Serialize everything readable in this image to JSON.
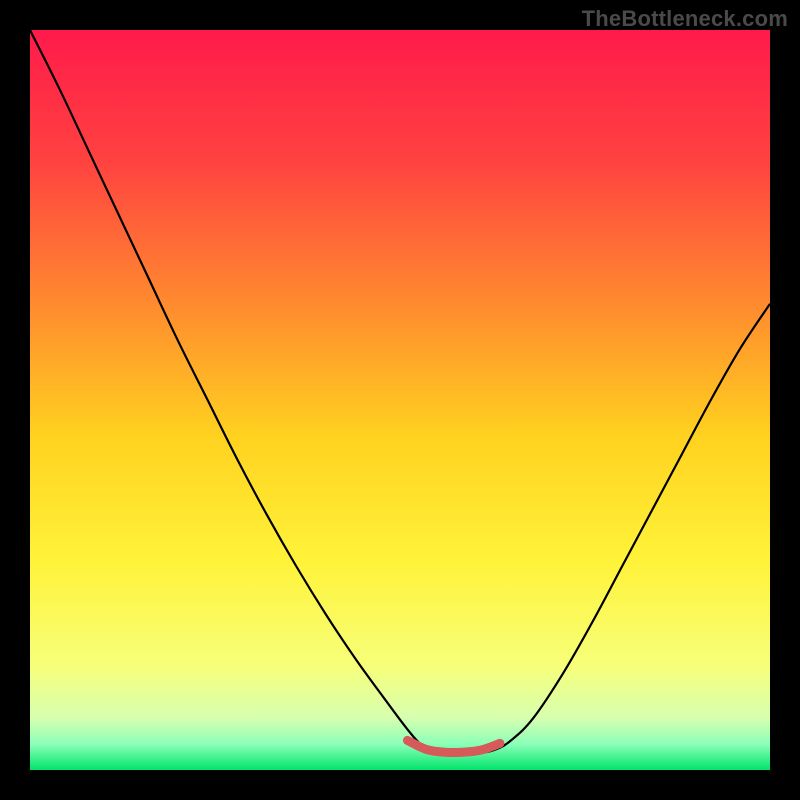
{
  "watermark": "TheBottleneck.com",
  "chart_data": {
    "type": "line",
    "title": "",
    "xlabel": "",
    "ylabel": "",
    "xlim": [
      0,
      100
    ],
    "ylim": [
      0,
      100
    ],
    "grid": false,
    "legend": false,
    "background_gradient": {
      "stops": [
        {
          "pos": 0.0,
          "color": "#ff1a4b"
        },
        {
          "pos": 0.18,
          "color": "#ff4340"
        },
        {
          "pos": 0.38,
          "color": "#ff8e2e"
        },
        {
          "pos": 0.55,
          "color": "#ffd21f"
        },
        {
          "pos": 0.72,
          "color": "#fff33a"
        },
        {
          "pos": 0.86,
          "color": "#f7ff7a"
        },
        {
          "pos": 0.93,
          "color": "#d6ffb0"
        },
        {
          "pos": 0.965,
          "color": "#8cffb8"
        },
        {
          "pos": 1.0,
          "color": "#00e56a"
        }
      ]
    },
    "series": [
      {
        "name": "curve",
        "color": "#000000",
        "width": 2.2,
        "x": [
          0,
          4,
          8,
          12,
          16,
          20,
          24,
          28,
          32,
          36,
          40,
          44,
          48,
          51,
          53,
          55,
          58,
          61,
          63,
          65,
          68,
          72,
          76,
          80,
          84,
          88,
          92,
          96,
          100
        ],
        "y": [
          100,
          92,
          83.5,
          75,
          66.5,
          58,
          50,
          42,
          34.5,
          27.5,
          21,
          15,
          9.5,
          5.5,
          3.3,
          2.4,
          2.2,
          2.3,
          2.8,
          4,
          7,
          13,
          20,
          27.5,
          35,
          42.5,
          50,
          57,
          63
        ]
      },
      {
        "name": "flat-highlight",
        "color": "#d65a5a",
        "width": 9,
        "linecap": "round",
        "x": [
          51,
          53.5,
          56,
          58.5,
          61,
          63.5
        ],
        "y": [
          4.0,
          2.8,
          2.4,
          2.4,
          2.7,
          3.6
        ]
      }
    ],
    "annotations": []
  }
}
